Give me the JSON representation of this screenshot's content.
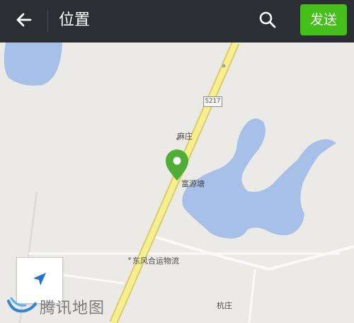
{
  "header": {
    "title": "位置",
    "send_label": "发送",
    "back_icon": "arrow-left-icon",
    "search_icon": "search-icon"
  },
  "map": {
    "labels": {
      "village_north": "麻庄",
      "marker_place": "富源塘",
      "logistics": "东风合运物流",
      "village_south": "杭庄"
    },
    "road_badge": "S217",
    "marker_color": "#4fae35",
    "water_color": "#a6c0e8",
    "road_color": "#f7ef8f",
    "watermark": "腾讯地图",
    "locate_icon": "navigation-arrow-icon"
  },
  "colors": {
    "topbar": "#2b2e32",
    "send_button": "#45c01a",
    "map_background": "#eceae6"
  }
}
